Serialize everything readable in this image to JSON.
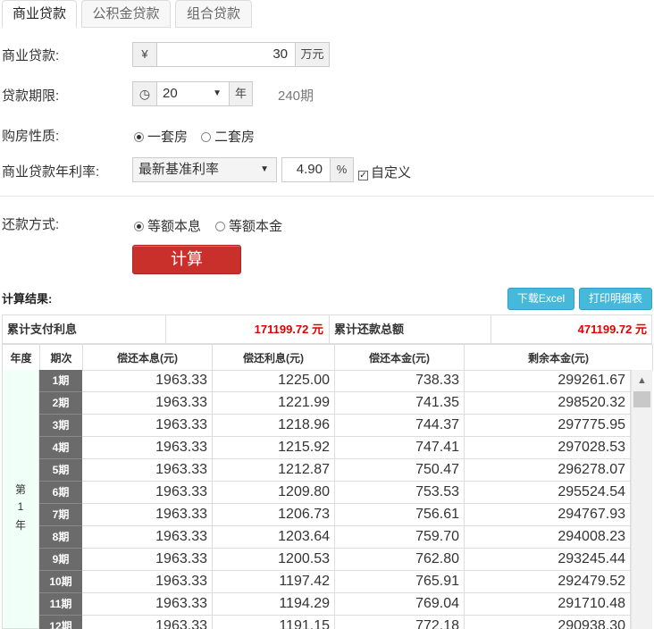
{
  "tabs": [
    {
      "label": "商业贷款",
      "active": true
    },
    {
      "label": "公积金贷款",
      "active": false
    },
    {
      "label": "组合贷款",
      "active": false
    }
  ],
  "form": {
    "loan_amount": {
      "label": "商业贷款:",
      "prefix": "¥",
      "value": "30",
      "unit": "万元"
    },
    "loan_term": {
      "label": "贷款期限:",
      "icon": "clock-icon",
      "value": "20",
      "unit": "年",
      "periods": "240期"
    },
    "property_type": {
      "label": "购房性质:",
      "options": [
        "一套房",
        "二套房"
      ],
      "selected": "一套房"
    },
    "interest_rate": {
      "label": "商业贷款年利率:",
      "rate_type": "最新基准利率",
      "value": "4.90",
      "unit": "%",
      "custom_label": "自定义",
      "custom_checked": true
    },
    "repayment_method": {
      "label": "还款方式:",
      "options": [
        "等额本息",
        "等额本金"
      ],
      "selected": "等额本息"
    }
  },
  "calculate_button": "计算",
  "results": {
    "title": "计算结果:",
    "download_excel": "下载Excel",
    "print_detail": "打印明细表",
    "total_interest_label": "累计支付利息",
    "total_interest_value": "171199.72 元",
    "total_repayment_label": "累计还款总额",
    "total_repayment_value": "471199.72 元",
    "columns": [
      "年度",
      "期次",
      "偿还本息(元)",
      "偿还利息(元)",
      "偿还本金(元)",
      "剩余本金(元)"
    ],
    "year_label": [
      "第",
      "1",
      "年"
    ],
    "rows": [
      {
        "period": "1期",
        "payment": "1963.33",
        "interest": "1225.00",
        "principal": "738.33",
        "remaining": "299261.67"
      },
      {
        "period": "2期",
        "payment": "1963.33",
        "interest": "1221.99",
        "principal": "741.35",
        "remaining": "298520.32"
      },
      {
        "period": "3期",
        "payment": "1963.33",
        "interest": "1218.96",
        "principal": "744.37",
        "remaining": "297775.95"
      },
      {
        "period": "4期",
        "payment": "1963.33",
        "interest": "1215.92",
        "principal": "747.41",
        "remaining": "297028.53"
      },
      {
        "period": "5期",
        "payment": "1963.33",
        "interest": "1212.87",
        "principal": "750.47",
        "remaining": "296278.07"
      },
      {
        "period": "6期",
        "payment": "1963.33",
        "interest": "1209.80",
        "principal": "753.53",
        "remaining": "295524.54"
      },
      {
        "period": "7期",
        "payment": "1963.33",
        "interest": "1206.73",
        "principal": "756.61",
        "remaining": "294767.93"
      },
      {
        "period": "8期",
        "payment": "1963.33",
        "interest": "1203.64",
        "principal": "759.70",
        "remaining": "294008.23"
      },
      {
        "period": "9期",
        "payment": "1963.33",
        "interest": "1200.53",
        "principal": "762.80",
        "remaining": "293245.44"
      },
      {
        "period": "10期",
        "payment": "1963.33",
        "interest": "1197.42",
        "principal": "765.91",
        "remaining": "292479.52"
      },
      {
        "period": "11期",
        "payment": "1963.33",
        "interest": "1194.29",
        "principal": "769.04",
        "remaining": "291710.48"
      },
      {
        "period": "12期",
        "payment": "1963.33",
        "interest": "1191.15",
        "principal": "772.18",
        "remaining": "290938.30"
      }
    ]
  },
  "colors": {
    "accent_red": "#c9302c",
    "value_red": "#e00000",
    "info_blue": "#46b8da",
    "period_gray": "#6b6b6b",
    "year_bg": "#f0fff7"
  }
}
